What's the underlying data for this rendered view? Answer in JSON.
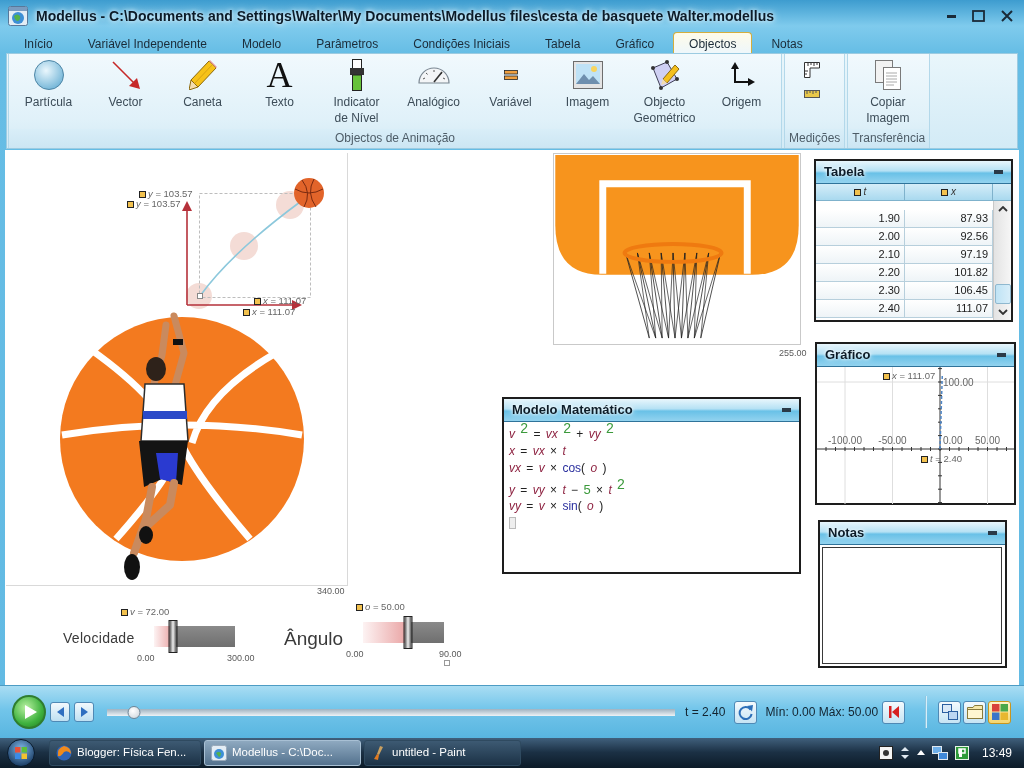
{
  "window": {
    "title": "Modellus - C:\\Documents and Settings\\Walter\\My Documents\\Modellus files\\cesta de basquete Walter.modellus"
  },
  "tabs": [
    {
      "label": "Início",
      "selected": false
    },
    {
      "label": "Variável Independente",
      "selected": false
    },
    {
      "label": "Modelo",
      "selected": false
    },
    {
      "label": "Parâmetros",
      "selected": false
    },
    {
      "label": "Condições Iniciais",
      "selected": false
    },
    {
      "label": "Tabela",
      "selected": false
    },
    {
      "label": "Gráfico",
      "selected": false
    },
    {
      "label": "Objectos",
      "selected": true
    },
    {
      "label": "Notas",
      "selected": false
    }
  ],
  "ribbon": [
    {
      "title": "Objectos de Animação",
      "items": [
        {
          "kind": "large",
          "label": "Partícula"
        },
        {
          "kind": "large",
          "label": "Vector"
        },
        {
          "kind": "large",
          "label": "Caneta"
        },
        {
          "kind": "large",
          "label": "Texto",
          "glyph": "A"
        },
        {
          "kind": "large",
          "label": "Indicator\nde Nível"
        },
        {
          "kind": "large",
          "label": "Analógico"
        },
        {
          "kind": "large",
          "label": "Variável"
        },
        {
          "kind": "large",
          "label": "Imagem"
        },
        {
          "kind": "large",
          "label": "Objecto\nGeométrico"
        },
        {
          "kind": "large",
          "label": "Origem"
        }
      ]
    },
    {
      "title": "Medições",
      "items": [
        {
          "kind": "small"
        },
        {
          "kind": "small"
        }
      ]
    },
    {
      "title": "Transferência",
      "items": [
        {
          "kind": "large",
          "label": "Copiar\nImagem"
        }
      ]
    }
  ],
  "canvas": {
    "readouts": [
      "*y* = 103.57",
      "*y* = 103.57",
      "*x* = 111.07",
      "*x* = 111.07"
    ],
    "size_label": "340.00"
  },
  "hoop_image": {
    "size_label": "255.00"
  },
  "sliders": [
    {
      "label": "Velocidade",
      "readout": "*v* = 72.00",
      "min": "0.00",
      "max": "300.00",
      "level": 0.24
    },
    {
      "label": "Ângulo",
      "readout": "*o* = 50.00",
      "min": "0.00",
      "max": "90.00",
      "level": 0.556
    }
  ],
  "model": {
    "title": "Modelo Matemático",
    "equations": [
      {
        "tokens": [
          {
            "kind": "var",
            "text": "v"
          },
          {
            "kind": "sup",
            "text": "2"
          },
          {
            "kind": "op",
            "text": "="
          },
          {
            "kind": "var",
            "text": "vx"
          },
          {
            "kind": "sup",
            "text": "2"
          },
          {
            "kind": "op",
            "text": "+"
          },
          {
            "kind": "var",
            "text": "vy"
          },
          {
            "kind": "sup",
            "text": "2"
          }
        ]
      },
      {
        "tokens": [
          {
            "kind": "var",
            "text": "x"
          },
          {
            "kind": "op",
            "text": "="
          },
          {
            "kind": "var",
            "text": "vx"
          },
          {
            "kind": "op",
            "text": "×"
          },
          {
            "kind": "var",
            "text": "t"
          }
        ]
      },
      {
        "tokens": [
          {
            "kind": "var",
            "text": "vx"
          },
          {
            "kind": "op",
            "text": "="
          },
          {
            "kind": "var",
            "text": "v"
          },
          {
            "kind": "op",
            "text": "×"
          },
          {
            "kind": "fn",
            "text": "cos"
          },
          {
            "kind": "op",
            "text": "("
          },
          {
            "kind": "var",
            "text": "o"
          },
          {
            "kind": "op",
            "text": ")"
          }
        ]
      },
      {
        "tokens": [
          {
            "kind": "var",
            "text": "y"
          },
          {
            "kind": "op",
            "text": "="
          },
          {
            "kind": "var",
            "text": "vy"
          },
          {
            "kind": "op",
            "text": "×"
          },
          {
            "kind": "var",
            "text": "t"
          },
          {
            "kind": "op",
            "text": "−"
          },
          {
            "kind": "num",
            "text": "5"
          },
          {
            "kind": "op",
            "text": "×"
          },
          {
            "kind": "var",
            "text": "t"
          },
          {
            "kind": "sup",
            "text": "2"
          }
        ]
      },
      {
        "tokens": [
          {
            "kind": "var",
            "text": "vy"
          },
          {
            "kind": "op",
            "text": "="
          },
          {
            "kind": "var",
            "text": "v"
          },
          {
            "kind": "op",
            "text": "×"
          },
          {
            "kind": "fn",
            "text": "sin"
          },
          {
            "kind": "op",
            "text": "("
          },
          {
            "kind": "var",
            "text": "o"
          },
          {
            "kind": "op",
            "text": ")"
          }
        ]
      }
    ]
  },
  "table": {
    "title": "Tabela",
    "columns": [
      "t",
      "x"
    ],
    "rows": [
      [
        "1.90",
        "87.93"
      ],
      [
        "2.00",
        "92.56"
      ],
      [
        "2.10",
        "97.19"
      ],
      [
        "2.20",
        "101.82"
      ],
      [
        "2.30",
        "106.45"
      ],
      [
        "2.40",
        "111.07"
      ]
    ]
  },
  "graph": {
    "title": "Gráfico",
    "readouts": [
      "*x* = 111.07",
      "*t* = 2.40"
    ],
    "x_axis_labels": [
      "-100.00",
      "-50.00",
      "0.00",
      "50.00"
    ],
    "y_axis_labels": [
      "100.00"
    ]
  },
  "notes": {
    "title": "Notas"
  },
  "controls": {
    "timeline": {
      "level": 0.048
    },
    "time": "t = 2.40",
    "range": "Mín: 0.00 Máx: 50.00",
    "view_buttons": [
      {
        "selected": false
      },
      {
        "selected": false
      },
      {
        "selected": true
      }
    ]
  },
  "taskbar": {
    "items": [
      {
        "label": "Blogger: Física Fen...",
        "selected": false
      },
      {
        "label": "Modellus - C:\\Doc...",
        "selected": true
      },
      {
        "label": "untitled - Paint",
        "selected": false
      }
    ],
    "clock": "13:49"
  }
}
